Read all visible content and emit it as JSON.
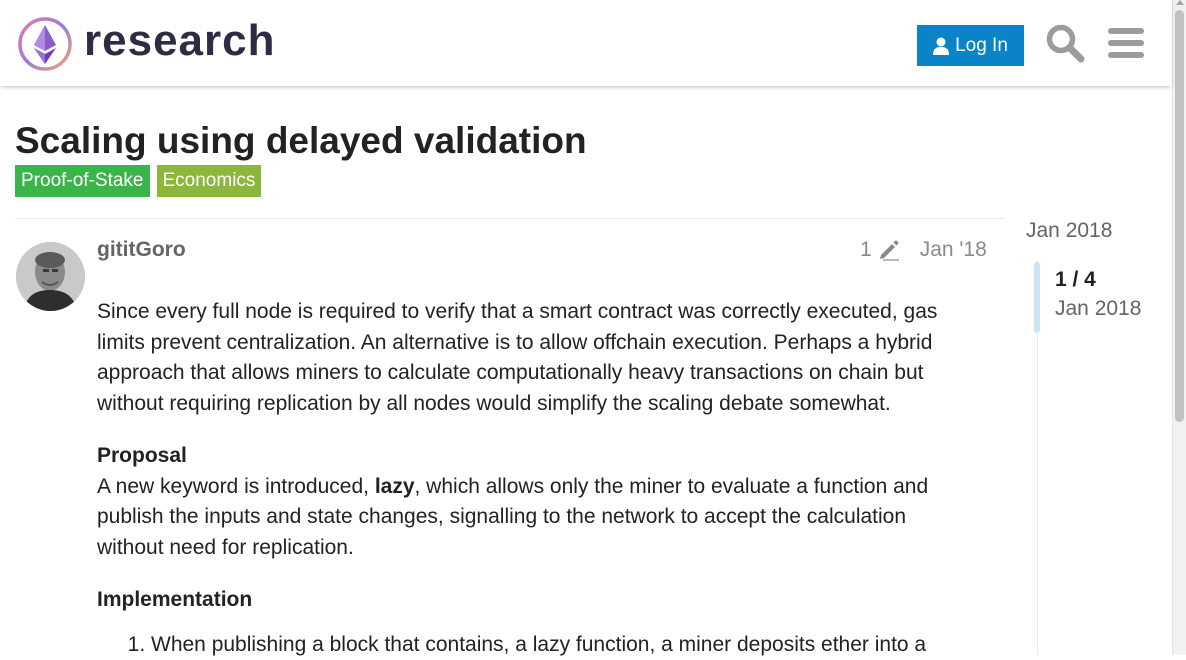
{
  "header": {
    "logo_text": "research",
    "login_label": "Log In"
  },
  "topic": {
    "title": "Scaling using delayed validation",
    "tags": [
      "Proof-of-Stake",
      "Economics"
    ]
  },
  "post": {
    "username": "gititGoro",
    "edit_count": "1",
    "date": "Jan '18",
    "paragraph1": "Since every full node is required to verify that a smart contract was correctly executed, gas limits prevent centralization. An alternative is to allow offchain execution. Perhaps a hybrid approach that allows miners to calculate computationally heavy transactions on chain but without requiring replication by all nodes would simplify the scaling debate somewhat.",
    "heading_proposal": "Proposal",
    "proposal_before": "A new keyword is introduced, ",
    "proposal_keyword": "lazy",
    "proposal_after": ", which allows only the miner to evaluate a function and publish the inputs and state changes, signalling to the network to accept the calculation without need for replication.",
    "heading_implementation": "Implementation",
    "list_item_1": "When publishing a block that contains, a lazy function, a miner deposits ether into a"
  },
  "timeline": {
    "start_date": "Jan 2018",
    "position": "1 / 4",
    "current_date": "Jan 2018"
  },
  "colors": {
    "accent": "#0a84c8",
    "tag_proof_of_stake": "#3ab54a",
    "tag_economics": "#8db63d"
  },
  "icons": [
    "ethereum-logo",
    "user-icon",
    "search-icon",
    "hamburger-menu-icon",
    "pencil-icon"
  ]
}
